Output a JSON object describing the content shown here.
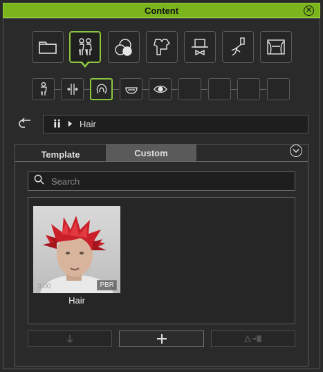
{
  "window": {
    "title": "Content",
    "close_icon": "close-circle-icon"
  },
  "categories": [
    {
      "name": "folder",
      "icon": "folder-icon"
    },
    {
      "name": "avatar",
      "icon": "avatar-icon",
      "active": true
    },
    {
      "name": "material",
      "icon": "material-spheres-icon"
    },
    {
      "name": "cloth",
      "icon": "cloth-icon"
    },
    {
      "name": "accessory",
      "icon": "accessory-hat-icon"
    },
    {
      "name": "motion",
      "icon": "motion-figure-icon"
    },
    {
      "name": "stage",
      "icon": "stage-curtain-icon"
    }
  ],
  "subcategories": [
    {
      "icon": "body-icon"
    },
    {
      "icon": "morph-icon"
    },
    {
      "icon": "hair-icon",
      "active": true
    },
    {
      "icon": "head-icon"
    },
    {
      "icon": "eye-icon"
    },
    {
      "icon": ""
    },
    {
      "icon": ""
    },
    {
      "icon": ""
    },
    {
      "icon": ""
    }
  ],
  "breadcrumb": {
    "path": "Hair"
  },
  "tabs": {
    "template": "Template",
    "custom": "Custom",
    "active": "custom"
  },
  "search": {
    "placeholder": "Search",
    "value": ""
  },
  "items": [
    {
      "caption": "Hair",
      "version": "3.00",
      "badge": "PBR"
    }
  ],
  "colors": {
    "accent": "#8cc63e",
    "titlebar": "#7ab51d"
  }
}
